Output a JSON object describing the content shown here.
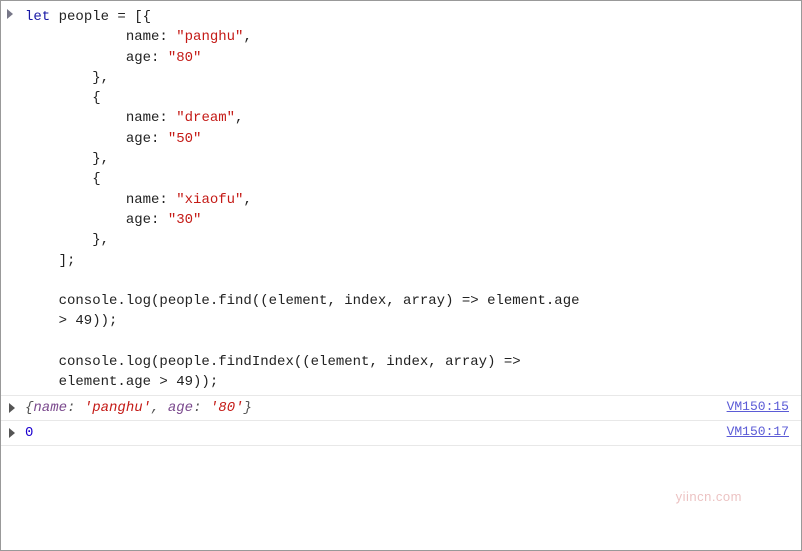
{
  "input": {
    "tokens": [
      {
        "t": "kw",
        "v": "let"
      },
      {
        "t": "txt",
        "v": " people = [{\n            name: "
      },
      {
        "t": "str",
        "v": "\"panghu\""
      },
      {
        "t": "txt",
        "v": ",\n            age: "
      },
      {
        "t": "str",
        "v": "\"80\""
      },
      {
        "t": "txt",
        "v": "\n        },\n        {\n            name: "
      },
      {
        "t": "str",
        "v": "\"dream\""
      },
      {
        "t": "txt",
        "v": ",\n            age: "
      },
      {
        "t": "str",
        "v": "\"50\""
      },
      {
        "t": "txt",
        "v": "\n        },\n        {\n            name: "
      },
      {
        "t": "str",
        "v": "\"xiaofu\""
      },
      {
        "t": "txt",
        "v": ",\n            age: "
      },
      {
        "t": "str",
        "v": "\"30\""
      },
      {
        "t": "txt",
        "v": "\n        },\n    ];\n\n    console.log(people.find((element, index, array) => element.age\n    > 49));\n\n    console.log(people.findIndex((element, index, array) =>\n    element.age > 49));"
      }
    ]
  },
  "outputs": [
    {
      "preview_tokens": [
        {
          "t": "txt",
          "v": "{"
        },
        {
          "t": "prop",
          "v": "name"
        },
        {
          "t": "txt",
          "v": ": "
        },
        {
          "t": "str",
          "v": "'panghu'"
        },
        {
          "t": "txt",
          "v": ", "
        },
        {
          "t": "prop",
          "v": "age"
        },
        {
          "t": "txt",
          "v": ": "
        },
        {
          "t": "str",
          "v": "'80'"
        },
        {
          "t": "txt",
          "v": "}"
        }
      ],
      "source": "VM150:15"
    },
    {
      "value": "0",
      "source": "VM150:17"
    }
  ],
  "watermark": "yiincn.com"
}
